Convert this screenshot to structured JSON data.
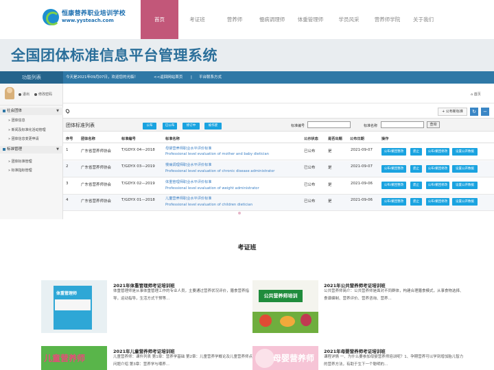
{
  "site": {
    "logo_cn": "恒康营养职业培训学校",
    "logo_en": "www.yysteach.com",
    "brand_color": "#c25779",
    "accent_color": "#1aa3e0"
  },
  "nav": [
    {
      "label": "首页",
      "active": true
    },
    {
      "label": "考证班",
      "active": false
    },
    {
      "label": "营养师",
      "active": false
    },
    {
      "label": "慢病调理师",
      "active": false
    },
    {
      "label": "体重管理师",
      "active": false
    },
    {
      "label": "学员风采",
      "active": false
    },
    {
      "label": "营养师学院",
      "active": false
    },
    {
      "label": "关于我们",
      "active": false
    }
  ],
  "banner": {
    "title": "全国团体标准信息平台管理系统"
  },
  "admin": {
    "func_list": "功能列表",
    "welcome": "今天是2021年09月07日，欢迎您的光临！",
    "back_home": "<<返回网站首页",
    "sep": "|",
    "contact": "平台联系方式",
    "logout": "退出",
    "change_pwd": "修改密码",
    "breadcrumb_home": "首页",
    "add_button": "+ 公布新标准",
    "refresh_icon": "refresh-icon",
    "collapse_icon": "minus-icon",
    "sidebar": {
      "group1": "社会团体",
      "group1_items": [
        "» 团体信息",
        "» 新闻及标准化活动管理",
        "» 团体信息变更申请"
      ],
      "group2": "标准管理",
      "group2_items": [
        "» 团体标准管理",
        "» 标准指标管理"
      ]
    },
    "panel_title": "团体标准列表",
    "panel_buttons": [
      "公布",
      "已公布",
      "修订中",
      "被作废"
    ],
    "filter_no_label": "标准编号",
    "filter_name_label": "标准名称",
    "search_button": "查询",
    "columns": [
      "序号",
      "团体名称",
      "标准编号",
      "标准名称",
      "公示状态",
      "是否出题",
      "公布日期",
      "操作"
    ],
    "row_actions": [
      "公布/撤回整改",
      "废止",
      "公布/撤回修改",
      "设置公开数据"
    ],
    "rows": [
      {
        "no": "1",
        "org": "广东省营养师协会",
        "code": "T/GDYX 04—2018",
        "name_cn": "母婴营养师职业水平评价标准",
        "name_en": "Professional level evaluation of mother and baby dietician",
        "status": "已公布",
        "question": "是",
        "date": "2021-09-07"
      },
      {
        "no": "2",
        "org": "广东省营养师协会",
        "code": "T/GDYX 03—2019",
        "name_cn": "慢病调理师职业水平评价标准",
        "name_en": "Professional level evaluation of chronic disease administrator",
        "status": "已公布",
        "question": "是",
        "date": "2021-09-07"
      },
      {
        "no": "3",
        "org": "广东省营养师协会",
        "code": "T/GDYX 02—2019",
        "name_cn": "体重管理师职业水平评价标准",
        "name_en": "Professional level evaluation of weight administrator",
        "status": "已公布",
        "question": "是",
        "date": "2021-09-06"
      },
      {
        "no": "4",
        "org": "广东省营养师协会",
        "code": "T/GDYX 01—2018",
        "name_cn": "儿童营养师职业水平评价标准",
        "name_en": "Professional level evaluation of children dietician",
        "status": "已公布",
        "question": "是",
        "date": "2021-09-06"
      }
    ]
  },
  "courses": {
    "title": "考证班",
    "cards": [
      {
        "title": "2021年体重管理师考证培训班",
        "desc": "体重管理师是从事体重管理工作的专业人员，主要通过营养状况评价，膳食营养指导，运动指导，生活方式干预等...",
        "img_label": "体重管理师"
      },
      {
        "title": "2021年公共营养师考证培训班",
        "desc": "公共营养师简介：公共营养师是面对不同群体，构建合理膳食模式，从事食物选择、食谱编制、营养评价、营养咨询、营养...",
        "img_label": "公共营养师培训"
      },
      {
        "title": "2021年儿童营养师考证培训班",
        "desc": "儿童营养师：课件列表 第1章：营养学基础 第2章：儿童营养学概论及儿童营养师点问题介绍 第3章：营养学与喂养...",
        "img_label": "儿童营养师"
      },
      {
        "title": "2021年母婴营养师考证培训班",
        "desc": "课程详情 一、为什么要参加母婴营养师培训呢？1、孕期营养可以学到增加胎儿智力的营养方法，有助于生下一个聪明的...",
        "img_label": "母婴营养师"
      }
    ]
  }
}
